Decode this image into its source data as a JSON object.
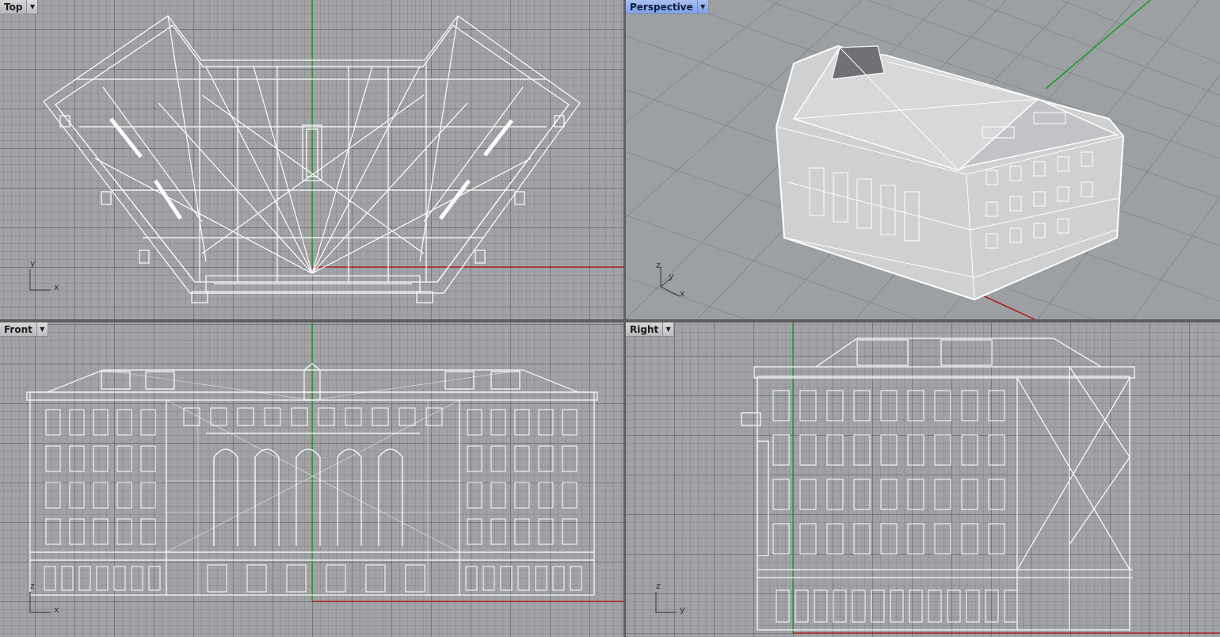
{
  "viewports": {
    "top": {
      "label": "Top"
    },
    "perspective": {
      "label": "Perspective",
      "active": true
    },
    "front": {
      "label": "Front"
    },
    "right": {
      "label": "Right"
    }
  },
  "gizmos": {
    "top": {
      "axis1": "y",
      "axis2": "x"
    },
    "perspective": {
      "axis1": "z",
      "axis2": "y",
      "axis3": "x"
    },
    "front": {
      "axis1": "z",
      "axis2": "x"
    },
    "right": {
      "axis1": "z",
      "axis2": "y"
    }
  },
  "icons": {
    "dropdown": "chevron-down-icon"
  },
  "colors": {
    "grid_bg": "#a0a2a5",
    "wire": "#ffffff",
    "x_axis": "#b0141a",
    "y_axis": "#169c1f",
    "active_tab": "#8fa9ee"
  }
}
